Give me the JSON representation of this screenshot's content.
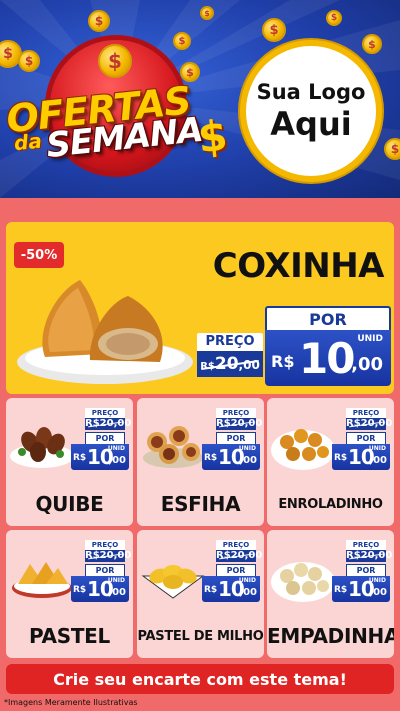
{
  "header": {
    "headline_top": "OFERTAS",
    "headline_mid": "da",
    "headline_bottom": "SEMANA",
    "dollar": "$",
    "logo_line1": "Sua Logo",
    "logo_line2": "Aqui"
  },
  "featured": {
    "discount": "-50%",
    "name": "COXINHA",
    "preco_label": "PREÇO",
    "old_currency": "R$",
    "old_int": "20",
    "old_cents": ",00",
    "por_label": "POR",
    "unid": "UNID",
    "currency": "R$",
    "price_int": "10",
    "price_cents": ",00"
  },
  "products": [
    {
      "name": "QUIBE",
      "preco_label": "PREÇO",
      "old_price": "R$20,00",
      "por_label": "POR",
      "unid": "UNID",
      "currency": "R$",
      "price_int": "10",
      "price_cents": ",00"
    },
    {
      "name": "ESFIHA",
      "preco_label": "PREÇO",
      "old_price": "R$20,00",
      "por_label": "POR",
      "unid": "UNID",
      "currency": "R$",
      "price_int": "10",
      "price_cents": ",00"
    },
    {
      "name": "ENROLADINHO",
      "preco_label": "PREÇO",
      "old_price": "R$20,00",
      "por_label": "POR",
      "unid": "UNID",
      "currency": "R$",
      "price_int": "10",
      "price_cents": ",00"
    },
    {
      "name": "PASTEL",
      "preco_label": "PREÇO",
      "old_price": "R$20,00",
      "por_label": "POR",
      "unid": "UNID",
      "currency": "R$",
      "price_int": "10",
      "price_cents": ",00"
    },
    {
      "name": "PASTEL DE MILHO",
      "preco_label": "PREÇO",
      "old_price": "R$20,00",
      "por_label": "POR",
      "unid": "UNID",
      "currency": "R$",
      "price_int": "10",
      "price_cents": ",00"
    },
    {
      "name": "EMPADINHA",
      "preco_label": "PREÇO",
      "old_price": "R$20,00",
      "por_label": "POR",
      "unid": "UNID",
      "currency": "R$",
      "price_int": "10",
      "price_cents": ",00"
    }
  ],
  "footer": {
    "cta": "Crie seu encarte com este tema!",
    "disclaimer": "*Imagens Meramente Ilustrativas"
  },
  "colors": {
    "header_blue": "#1f3ea8",
    "background_red": "#f06a6a",
    "featured_yellow": "#fbc91f",
    "card_pink": "#fbd4d4",
    "price_blue": "#1a3a9a",
    "cta_red": "#e02424",
    "gold": "#f5b800"
  }
}
